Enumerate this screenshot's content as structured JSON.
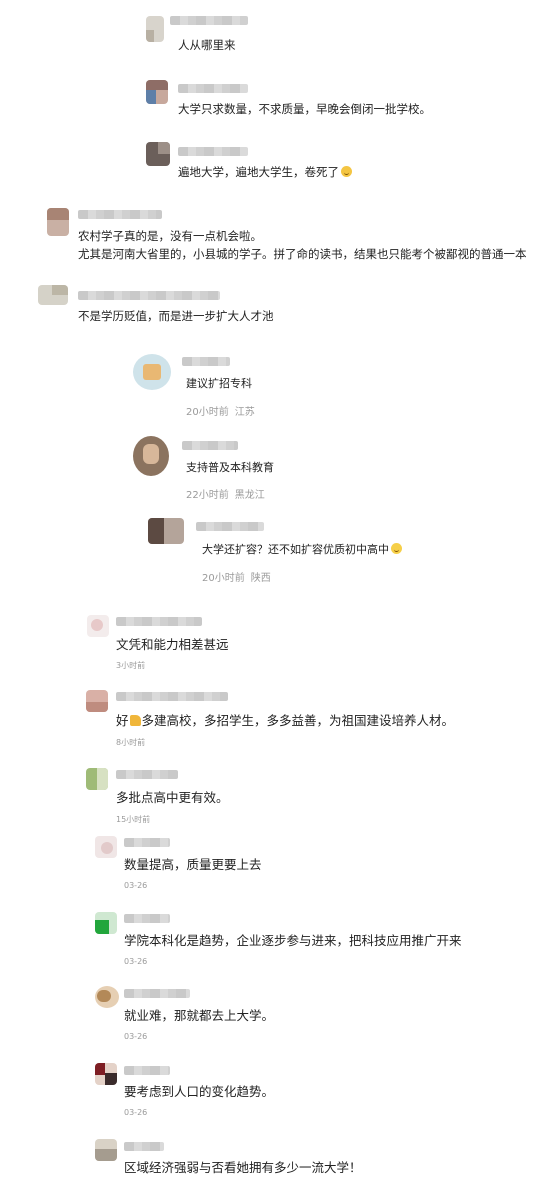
{
  "comments": [
    {
      "text": "人从哪里来"
    },
    {
      "text": "大学只求数量，不求质量，早晚会倒闭一批学校。"
    },
    {
      "text": "遍地大学，遍地大学生，卷死了"
    },
    {
      "line1": "农村学子真的是，没有一点机会啦。",
      "line2": "尤其是河南大省里的，小县城的学子。拼了命的读书，结果也只能考个被鄙视的普通一本"
    },
    {
      "text": "不是学历贬值，而是进一步扩大人才池"
    },
    {
      "text": "建议扩招专科",
      "time": "20小时前",
      "location": "江苏"
    },
    {
      "text": "支持普及本科教育",
      "time": "22小时前",
      "location": "黑龙江"
    },
    {
      "text": "大学还扩容？还不如扩容优质初中高中",
      "time": "20小时前",
      "location": "陕西"
    },
    {
      "text": "文凭和能力相差甚远",
      "time": "3小时前"
    },
    {
      "text_a": "好",
      "text_b": "多建高校，多招学生，多多益善，为祖国建设培养人材。",
      "time": "8小时前"
    },
    {
      "text": "多批点高中更有效。",
      "time": "15小时前"
    },
    {
      "text": "数量提高，质量更要上去",
      "time": "03-26"
    },
    {
      "text": "学院本科化是趋势，企业逐步参与进来，把科技应用推广开来",
      "time": "03-26"
    },
    {
      "text": "就业难，那就都去上大学。",
      "time": "03-26"
    },
    {
      "text": "要考虑到人口的变化趋势。",
      "time": "03-26"
    },
    {
      "text": "区域经济强弱与否看她拥有多少一流大学！"
    }
  ],
  "icons": {
    "smile": "smile-emoji-icon",
    "thumbs_up": "thumbs-up-emoji-icon",
    "laugh": "laugh-emoji-icon"
  }
}
